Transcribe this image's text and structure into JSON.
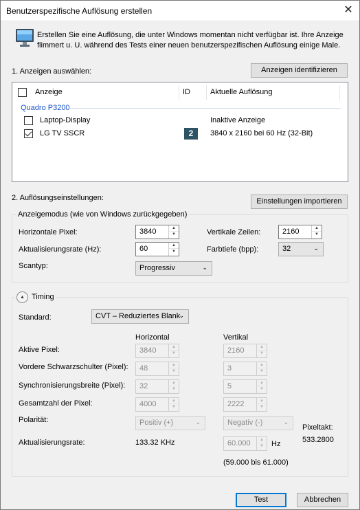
{
  "window": {
    "title": "Benutzerspezifische Auflösung erstellen",
    "close_glyph": "✕"
  },
  "info": {
    "line1": "Erstellen Sie eine Auflösung, die unter Windows momentan nicht verfügbar ist. Ihre Anzeige",
    "line2": "flimmert u. U. während des Tests einer neuen benutzerspezifischen Auflösung einige Male."
  },
  "section1": {
    "label": "1. Anzeigen auswählen:",
    "identify_button": "Anzeigen identifizieren"
  },
  "display_list": {
    "headers": {
      "display": "Anzeige",
      "id": "ID",
      "resolution": "Aktuelle Auflösung"
    },
    "group": "Quadro P3200",
    "rows": [
      {
        "name": "Laptop-Display",
        "checked": false,
        "id": "",
        "resolution": "Inaktive Anzeige"
      },
      {
        "name": "LG TV SSCR",
        "checked": true,
        "id": "2",
        "resolution": "3840 x 2160 bei 60 Hz (32-Bit)"
      }
    ]
  },
  "section2": {
    "label": "2. Auflösungseinstellungen:",
    "import_button": "Einstellungen importieren"
  },
  "mode": {
    "group_label": "Anzeigemodus (wie von Windows zurückgegeben)",
    "h_pixels_label": "Horizontale Pixel:",
    "h_pixels": "3840",
    "v_lines_label": "Vertikale Zeilen:",
    "v_lines": "2160",
    "refresh_label": "Aktualisierungsrate (Hz):",
    "refresh": "60",
    "depth_label": "Farbtiefe (bpp):",
    "depth": "32",
    "scan_label": "Scantyp:",
    "scan": "Progressiv"
  },
  "timing": {
    "toggle_label": "Timing",
    "standard_label": "Standard:",
    "standard": "CVT – Reduziertes Blank",
    "col_horizontal": "Horizontal",
    "col_vertical": "Vertikal",
    "rows": [
      {
        "label": "Aktive Pixel:",
        "h": "3840",
        "v": "2160"
      },
      {
        "label": "Vordere Schwarzschulter (Pixel):",
        "h": "48",
        "v": "3"
      },
      {
        "label": "Synchronisierungsbreite (Pixel):",
        "h": "32",
        "v": "5"
      },
      {
        "label": "Gesamtzahl der Pixel:",
        "h": "4000",
        "v": "2222"
      }
    ],
    "polarity_label": "Polarität:",
    "polarity_h": "Positiv (+)",
    "polarity_v": "Negativ (-)",
    "pixelclock_label": "Pixeltakt:",
    "pixelclock_value": "533.2800",
    "refresh_label": "Aktualisierungsrate:",
    "refresh_h": "133.32 KHz",
    "refresh_v": "60.000",
    "refresh_v_unit": "Hz",
    "refresh_range": "(59.000 bis 61.000)"
  },
  "buttons": {
    "test": "Test",
    "cancel": "Abbrechen"
  },
  "colors": {
    "accent": "#0078d7",
    "group_text": "#1a56c8",
    "id_badge": "#2c5364"
  }
}
